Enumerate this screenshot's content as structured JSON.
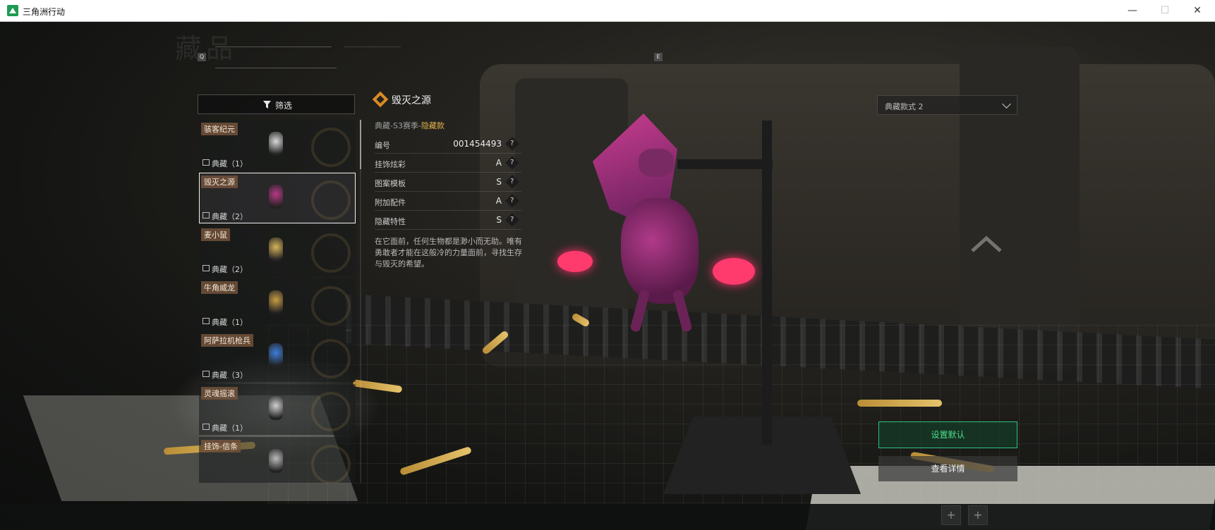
{
  "window": {
    "title": "三角洲行动",
    "minimize": "—",
    "maximize": "☐",
    "close": "✕"
  },
  "header": {
    "heading": "藏品",
    "key_left": "Q",
    "key_right": "E"
  },
  "filter": {
    "label": "筛选"
  },
  "list": [
    {
      "name": "骇客纪元",
      "rarity": "典藏（1）",
      "color": "#d8d8d8"
    },
    {
      "name": "毁灭之源",
      "rarity": "典藏（2）",
      "color": "#b63a86"
    },
    {
      "name": "麦小鼠",
      "rarity": "典藏（2）",
      "color": "#d6b25a"
    },
    {
      "name": "牛角威龙",
      "rarity": "典藏（1）",
      "color": "#c79c45"
    },
    {
      "name": "阿萨拉机枪兵",
      "rarity": "典藏（3）",
      "color": "#3f7ed8"
    },
    {
      "name": "灵魂摇滚",
      "rarity": "典藏（1）",
      "color": "#cfcfcf"
    },
    {
      "name": "挂饰-信条",
      "rarity": "",
      "color": "#bbbbbb"
    }
  ],
  "selected_index": 1,
  "detail": {
    "title": "毁灭之源",
    "season": "典藏-S3赛季-",
    "season_tag": "隐藏款",
    "props": [
      {
        "label": "编号",
        "value": "001454493"
      },
      {
        "label": "挂饰炫彩",
        "value": "A"
      },
      {
        "label": "图案模板",
        "value": "S"
      },
      {
        "label": "附加配件",
        "value": "A"
      },
      {
        "label": "隐藏特性",
        "value": "S"
      }
    ],
    "help": "?",
    "description": "在它面前，任何生物都是渺小而无助。唯有勇敢者才能在这般冷的力量面前，寻找生存与毁灭的希望。"
  },
  "style_select": {
    "value": "典藏款式 2"
  },
  "actions": {
    "set_default": "设置默认",
    "view_detail": "查看详情"
  },
  "bottom": {
    "plus": "+"
  },
  "colors": {
    "accent_green": "#2ec27e",
    "rarity_gold": "#e0b14a",
    "pendant_glow": "#ff2d6a"
  }
}
